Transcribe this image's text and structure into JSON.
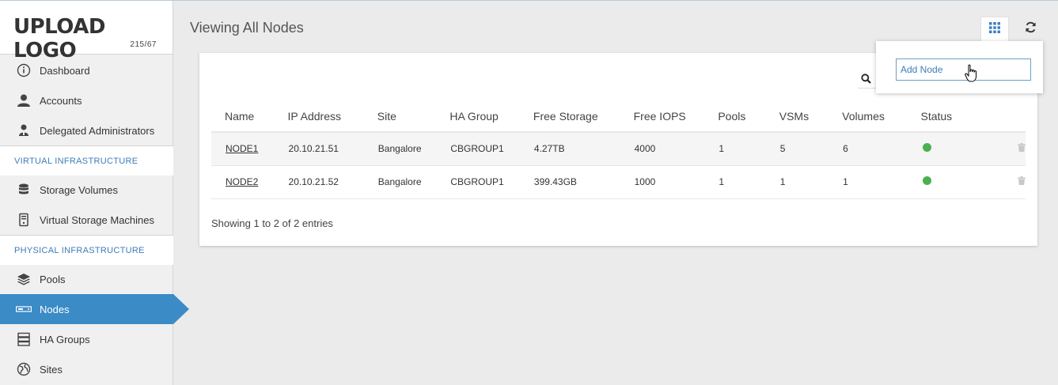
{
  "logo": {
    "text": "UPLOAD LOGO",
    "size": "215/67"
  },
  "sidebar": {
    "items": [
      {
        "label": "Dashboard",
        "icon": "info-icon"
      },
      {
        "label": "Accounts",
        "icon": "user-icon"
      },
      {
        "label": "Delegated Administrators",
        "icon": "users-icon"
      }
    ],
    "section_virtual": "VIRTUAL INFRASTRUCTURE",
    "virtual_items": [
      {
        "label": "Storage Volumes",
        "icon": "database-icon"
      },
      {
        "label": "Virtual Storage Machines",
        "icon": "server-icon"
      }
    ],
    "section_physical": "PHYSICAL INFRASTRUCTURE",
    "physical_items": [
      {
        "label": "Pools",
        "icon": "layers-icon"
      },
      {
        "label": "Nodes",
        "icon": "node-icon",
        "active": true
      },
      {
        "label": "HA Groups",
        "icon": "server-stack-icon"
      },
      {
        "label": "Sites",
        "icon": "globe-icon"
      }
    ]
  },
  "header": {
    "title": "Viewing All Nodes"
  },
  "dropdown": {
    "add_node": "Add Node"
  },
  "table": {
    "columns": [
      "Name",
      "IP Address",
      "Site",
      "HA Group",
      "Free Storage",
      "Free IOPS",
      "Pools",
      "VSMs",
      "Volumes",
      "Status"
    ],
    "rows": [
      {
        "name": "NODE1",
        "ip": "20.10.21.51",
        "site": "Bangalore",
        "ha_group": "CBGROUP1",
        "free_storage": "4.27TB",
        "free_iops": "4000",
        "pools": "1",
        "vsms": "5",
        "volumes": "6",
        "status": "online"
      },
      {
        "name": "NODE2",
        "ip": "20.10.21.52",
        "site": "Bangalore",
        "ha_group": "CBGROUP1",
        "free_storage": "399.43GB",
        "free_iops": "1000",
        "pools": "1",
        "vsms": "1",
        "volumes": "1",
        "status": "online"
      }
    ]
  },
  "footer": {
    "entries": "Showing 1 to 2 of 2 entries"
  },
  "colors": {
    "accent": "#3b8bc7",
    "status_online": "#4cb050",
    "section_text": "#3d7db8"
  }
}
